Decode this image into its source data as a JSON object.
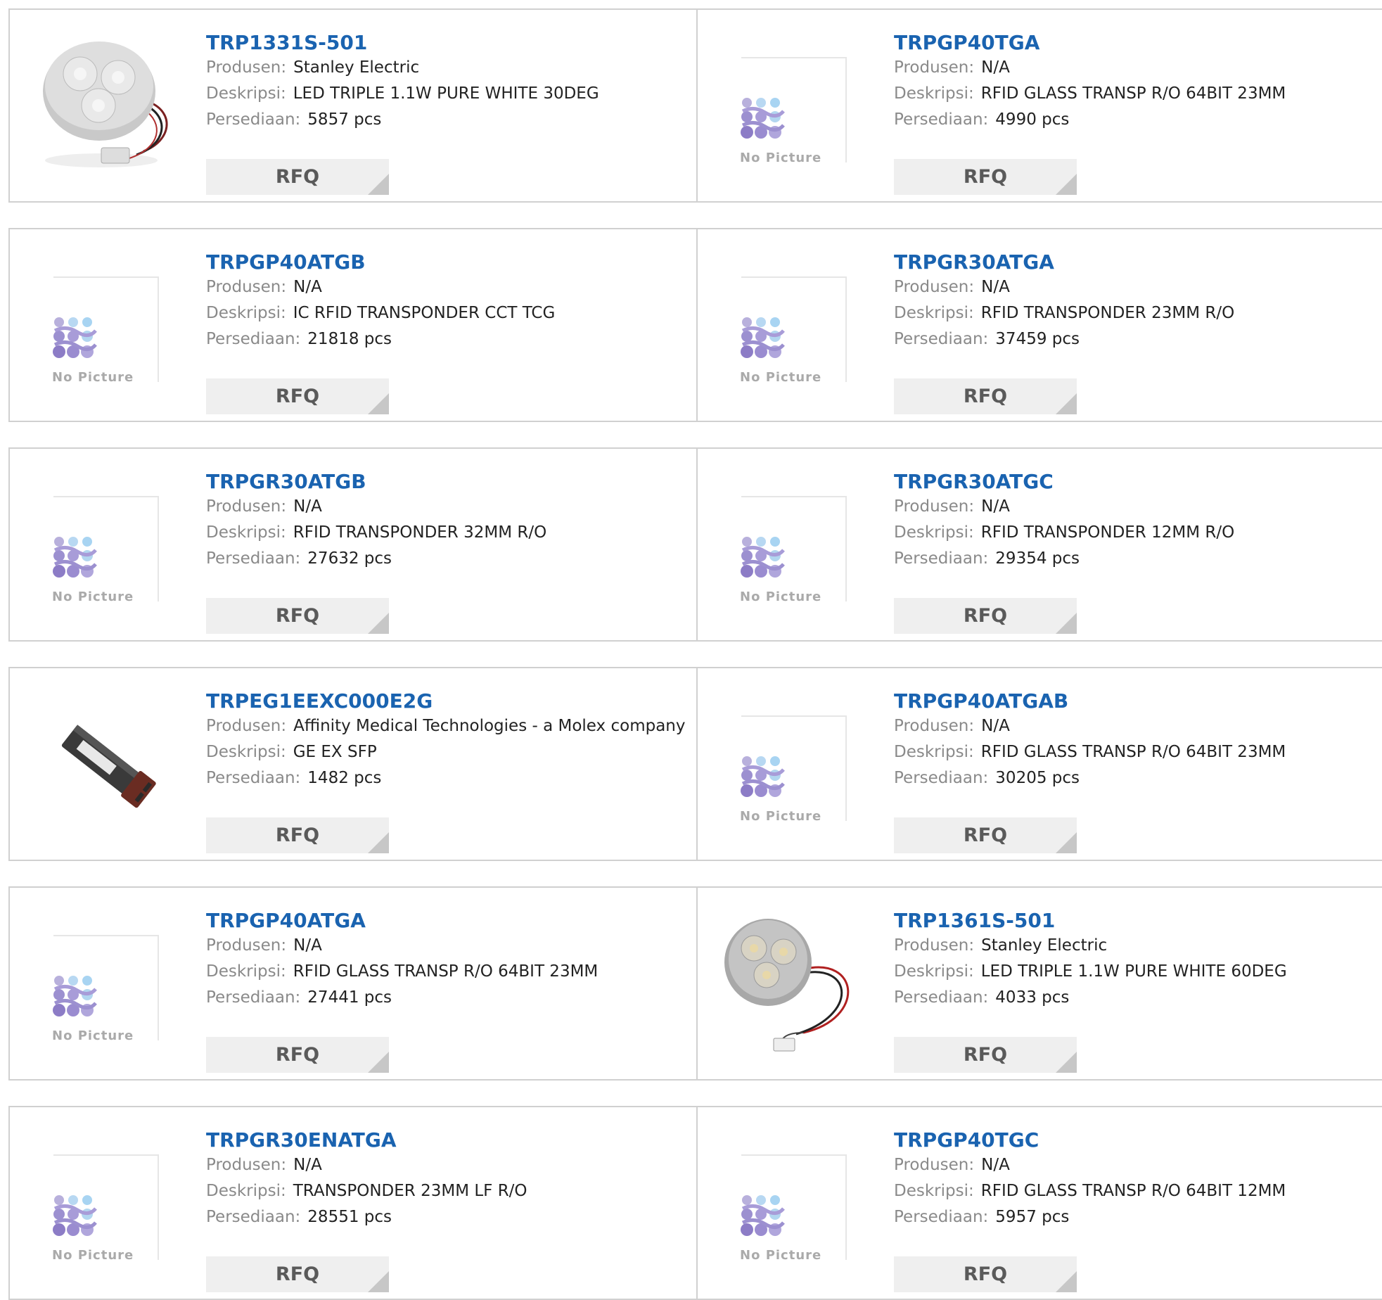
{
  "labels": {
    "manufacturer": "Produsen:",
    "description": "Deskripsi:",
    "stock": "Persediaan:",
    "rfq": "RFQ",
    "no_picture": "No Picture"
  },
  "products": [
    {
      "part": "TRP1331S-501",
      "manufacturer": "Stanley Electric",
      "description": "LED TRIPLE 1.1W PURE WHITE 30DEG",
      "stock": "5857 pcs",
      "image": "led-module-photo"
    },
    {
      "part": "TRPGP40TGA",
      "manufacturer": "N/A",
      "description": "RFID GLASS TRANSP R/O 64BIT 23MM",
      "stock": "4990 pcs",
      "image": "no-picture"
    },
    {
      "part": "TRPGP40ATGB",
      "manufacturer": "N/A",
      "description": "IC RFID TRANSPONDER CCT TCG",
      "stock": "21818 pcs",
      "image": "no-picture"
    },
    {
      "part": "TRPGR30ATGA",
      "manufacturer": "N/A",
      "description": "RFID TRANSPONDER 23MM R/O",
      "stock": "37459 pcs",
      "image": "no-picture"
    },
    {
      "part": "TRPGR30ATGB",
      "manufacturer": "N/A",
      "description": "RFID TRANSPONDER 32MM R/O",
      "stock": "27632 pcs",
      "image": "no-picture"
    },
    {
      "part": "TRPGR30ATGC",
      "manufacturer": "N/A",
      "description": "RFID TRANSPONDER 12MM R/O",
      "stock": "29354 pcs",
      "image": "no-picture"
    },
    {
      "part": "TRPEG1EEXC000E2G",
      "manufacturer": "Affinity Medical Technologies - a Molex company",
      "description": "GE EX SFP",
      "stock": "1482 pcs",
      "image": "sfp-module-photo"
    },
    {
      "part": "TRPGP40ATGAB",
      "manufacturer": "N/A",
      "description": "RFID GLASS TRANSP R/O 64BIT 23MM",
      "stock": "30205 pcs",
      "image": "no-picture"
    },
    {
      "part": "TRPGP40ATGA",
      "manufacturer": "N/A",
      "description": "RFID GLASS TRANSP R/O 64BIT 23MM",
      "stock": "27441 pcs",
      "image": "no-picture"
    },
    {
      "part": "TRP1361S-501",
      "manufacturer": "Stanley Electric",
      "description": "LED TRIPLE 1.1W PURE WHITE 60DEG",
      "stock": "4033 pcs",
      "image": "led-module-photo"
    },
    {
      "part": "TRPGR30ENATGA",
      "manufacturer": "N/A",
      "description": "TRANSPONDER 23MM LF R/O",
      "stock": "28551 pcs",
      "image": "no-picture"
    },
    {
      "part": "TRPGP40TGC",
      "manufacturer": "N/A",
      "description": "RFID GLASS TRANSP R/O 64BIT 12MM",
      "stock": "5957 pcs",
      "image": "no-picture"
    }
  ]
}
